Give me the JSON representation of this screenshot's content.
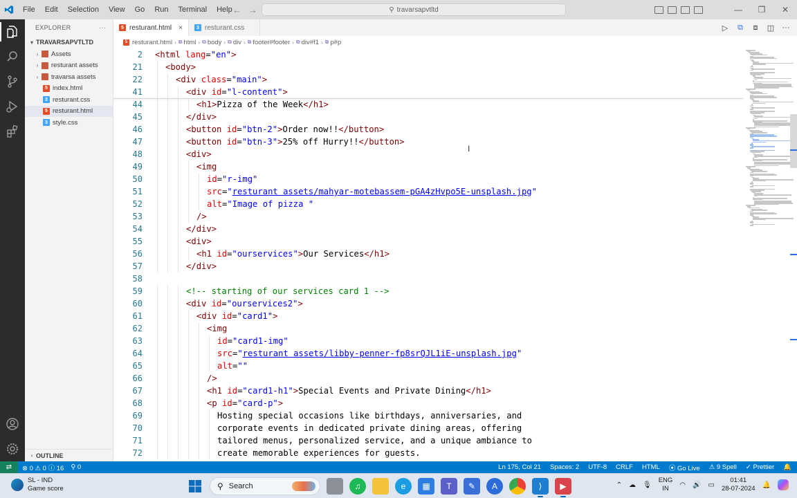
{
  "window": {
    "title": "travarsapvtltd",
    "menu": [
      "File",
      "Edit",
      "Selection",
      "View",
      "Go",
      "Run",
      "Terminal",
      "Help"
    ]
  },
  "sidebar": {
    "header": "EXPLORER",
    "more": "···",
    "root": "TRAVARSAPVTLTD",
    "items": [
      {
        "label": "Assets",
        "type": "folder"
      },
      {
        "label": "resturant assets",
        "type": "folder"
      },
      {
        "label": "travarsa assets",
        "type": "folder"
      },
      {
        "label": "index.html",
        "type": "html"
      },
      {
        "label": "resturant.css",
        "type": "css"
      },
      {
        "label": "resturant.html",
        "type": "html"
      },
      {
        "label": "style.css",
        "type": "css"
      }
    ],
    "outline": "OUTLINE"
  },
  "tabs": [
    {
      "label": "resturant.html",
      "type": "html",
      "close": "×"
    },
    {
      "label": "resturant.css",
      "type": "css"
    }
  ],
  "breadcrumb": [
    "resturant.html",
    "html",
    "body",
    "div",
    "footer#footer",
    "div#f1",
    "p#p"
  ],
  "code": {
    "sticky": [
      {
        "ln": "2",
        "indent": 0,
        "tokens": [
          [
            "p",
            "<"
          ],
          [
            "tag",
            "html"
          ],
          [
            "t",
            " "
          ],
          [
            "attr",
            "lang"
          ],
          [
            "t",
            "="
          ],
          [
            "val",
            "\"en\""
          ],
          [
            "p",
            ">"
          ]
        ]
      },
      {
        "ln": "21",
        "indent": 1,
        "tokens": [
          [
            "p",
            "<"
          ],
          [
            "tag",
            "body"
          ],
          [
            "p",
            ">"
          ]
        ]
      },
      {
        "ln": "22",
        "indent": 2,
        "tokens": [
          [
            "p",
            "<"
          ],
          [
            "tag",
            "div"
          ],
          [
            "t",
            " "
          ],
          [
            "attr",
            "class"
          ],
          [
            "t",
            "="
          ],
          [
            "val",
            "\"main\""
          ],
          [
            "p",
            ">"
          ]
        ]
      },
      {
        "ln": "41",
        "indent": 3,
        "tokens": [
          [
            "p",
            "<"
          ],
          [
            "tag",
            "div"
          ],
          [
            "t",
            " "
          ],
          [
            "attr",
            "id"
          ],
          [
            "t",
            "="
          ],
          [
            "val",
            "\"l-content\""
          ],
          [
            "p",
            ">"
          ]
        ]
      }
    ],
    "lines": [
      {
        "ln": "44",
        "indent": 4,
        "tokens": [
          [
            "p",
            "<"
          ],
          [
            "tag",
            "h1"
          ],
          [
            "p",
            ">"
          ],
          [
            "t",
            "Pizza of the Week"
          ],
          [
            "p",
            "</"
          ],
          [
            "tag",
            "h1"
          ],
          [
            "p",
            ">"
          ]
        ]
      },
      {
        "ln": "45",
        "indent": 3,
        "tokens": [
          [
            "p",
            "</"
          ],
          [
            "tag",
            "div"
          ],
          [
            "p",
            ">"
          ]
        ]
      },
      {
        "ln": "46",
        "indent": 3,
        "tokens": [
          [
            "p",
            "<"
          ],
          [
            "tag",
            "button"
          ],
          [
            "t",
            " "
          ],
          [
            "attr",
            "id"
          ],
          [
            "t",
            "="
          ],
          [
            "val",
            "\"btn-2\""
          ],
          [
            "p",
            ">"
          ],
          [
            "t",
            "Order now!!"
          ],
          [
            "p",
            "</"
          ],
          [
            "tag",
            "button"
          ],
          [
            "p",
            ">"
          ]
        ]
      },
      {
        "ln": "47",
        "indent": 3,
        "tokens": [
          [
            "p",
            "<"
          ],
          [
            "tag",
            "button"
          ],
          [
            "t",
            " "
          ],
          [
            "attr",
            "id"
          ],
          [
            "t",
            "="
          ],
          [
            "val",
            "\"btn-3\""
          ],
          [
            "p",
            ">"
          ],
          [
            "t",
            "25% off Hurry!!"
          ],
          [
            "p",
            "</"
          ],
          [
            "tag",
            "button"
          ],
          [
            "p",
            ">"
          ]
        ]
      },
      {
        "ln": "48",
        "indent": 3,
        "tokens": [
          [
            "p",
            "<"
          ],
          [
            "tag",
            "div"
          ],
          [
            "p",
            ">"
          ]
        ]
      },
      {
        "ln": "49",
        "indent": 4,
        "tokens": [
          [
            "p",
            "<"
          ],
          [
            "tag",
            "img"
          ]
        ]
      },
      {
        "ln": "50",
        "indent": 5,
        "tokens": [
          [
            "attr",
            "id"
          ],
          [
            "t",
            "="
          ],
          [
            "val",
            "\"r-img\""
          ]
        ]
      },
      {
        "ln": "51",
        "indent": 5,
        "tokens": [
          [
            "attr",
            "src"
          ],
          [
            "t",
            "="
          ],
          [
            "val",
            "\""
          ],
          [
            "link",
            "resturant assets/mahyar-motebassem-pGA4zHvpo5E-unsplash.jpg"
          ],
          [
            "val",
            "\""
          ]
        ]
      },
      {
        "ln": "52",
        "indent": 5,
        "tokens": [
          [
            "attr",
            "alt"
          ],
          [
            "t",
            "="
          ],
          [
            "val",
            "\"Image of pizza \""
          ]
        ]
      },
      {
        "ln": "53",
        "indent": 4,
        "tokens": [
          [
            "p",
            "/>"
          ]
        ]
      },
      {
        "ln": "54",
        "indent": 3,
        "tokens": [
          [
            "p",
            "</"
          ],
          [
            "tag",
            "div"
          ],
          [
            "p",
            ">"
          ]
        ]
      },
      {
        "ln": "55",
        "indent": 3,
        "tokens": [
          [
            "p",
            "<"
          ],
          [
            "tag",
            "div"
          ],
          [
            "p",
            ">"
          ]
        ]
      },
      {
        "ln": "56",
        "indent": 4,
        "tokens": [
          [
            "p",
            "<"
          ],
          [
            "tag",
            "h1"
          ],
          [
            "t",
            " "
          ],
          [
            "attr",
            "id"
          ],
          [
            "t",
            "="
          ],
          [
            "val",
            "\"ourservices\""
          ],
          [
            "p",
            ">"
          ],
          [
            "t",
            "Our Services"
          ],
          [
            "p",
            "</"
          ],
          [
            "tag",
            "h1"
          ],
          [
            "p",
            ">"
          ]
        ]
      },
      {
        "ln": "57",
        "indent": 3,
        "tokens": [
          [
            "p",
            "</"
          ],
          [
            "tag",
            "div"
          ],
          [
            "p",
            ">"
          ]
        ]
      },
      {
        "ln": "58",
        "indent": 0,
        "tokens": []
      },
      {
        "ln": "59",
        "indent": 3,
        "tokens": [
          [
            "c",
            "<!-- starting of our services card 1 -->"
          ]
        ]
      },
      {
        "ln": "60",
        "indent": 3,
        "tokens": [
          [
            "p",
            "<"
          ],
          [
            "tag",
            "div"
          ],
          [
            "t",
            " "
          ],
          [
            "attr",
            "id"
          ],
          [
            "t",
            "="
          ],
          [
            "val",
            "\"ourservices2\""
          ],
          [
            "p",
            ">"
          ]
        ]
      },
      {
        "ln": "61",
        "indent": 4,
        "tokens": [
          [
            "p",
            "<"
          ],
          [
            "tag",
            "div"
          ],
          [
            "t",
            " "
          ],
          [
            "attr",
            "id"
          ],
          [
            "t",
            "="
          ],
          [
            "val",
            "\"card1\""
          ],
          [
            "p",
            ">"
          ]
        ]
      },
      {
        "ln": "62",
        "indent": 5,
        "tokens": [
          [
            "p",
            "<"
          ],
          [
            "tag",
            "img"
          ]
        ]
      },
      {
        "ln": "63",
        "indent": 6,
        "tokens": [
          [
            "attr",
            "id"
          ],
          [
            "t",
            "="
          ],
          [
            "val",
            "\"card1-img\""
          ]
        ]
      },
      {
        "ln": "64",
        "indent": 6,
        "tokens": [
          [
            "attr",
            "src"
          ],
          [
            "t",
            "="
          ],
          [
            "val",
            "\""
          ],
          [
            "link",
            "resturant assets/libby-penner-fp8srQJL1iE-unsplash.jpg"
          ],
          [
            "val",
            "\""
          ]
        ]
      },
      {
        "ln": "65",
        "indent": 6,
        "tokens": [
          [
            "attr",
            "alt"
          ],
          [
            "t",
            "="
          ],
          [
            "val",
            "\"\""
          ]
        ]
      },
      {
        "ln": "66",
        "indent": 5,
        "tokens": [
          [
            "p",
            "/>"
          ]
        ]
      },
      {
        "ln": "67",
        "indent": 5,
        "tokens": [
          [
            "p",
            "<"
          ],
          [
            "tag",
            "h1"
          ],
          [
            "t",
            " "
          ],
          [
            "attr",
            "id"
          ],
          [
            "t",
            "="
          ],
          [
            "val",
            "\"card1-h1\""
          ],
          [
            "p",
            ">"
          ],
          [
            "t",
            "Special Events and Private Dining"
          ],
          [
            "p",
            "</"
          ],
          [
            "tag",
            "h1"
          ],
          [
            "p",
            ">"
          ]
        ]
      },
      {
        "ln": "68",
        "indent": 5,
        "tokens": [
          [
            "p",
            "<"
          ],
          [
            "tag",
            "p"
          ],
          [
            "t",
            " "
          ],
          [
            "attr",
            "id"
          ],
          [
            "t",
            "="
          ],
          [
            "val",
            "\"card-p\""
          ],
          [
            "p",
            ">"
          ]
        ]
      },
      {
        "ln": "69",
        "indent": 6,
        "tokens": [
          [
            "t",
            "Hosting special occasions like birthdays, anniversaries, and"
          ]
        ]
      },
      {
        "ln": "70",
        "indent": 6,
        "tokens": [
          [
            "t",
            "corporate events in dedicated private dining areas, offering"
          ]
        ]
      },
      {
        "ln": "71",
        "indent": 6,
        "tokens": [
          [
            "t",
            "tailored menus, personalized service, and a unique ambiance to"
          ]
        ]
      },
      {
        "ln": "72",
        "indent": 6,
        "tokens": [
          [
            "t",
            "create memorable experiences for guests."
          ]
        ]
      }
    ]
  },
  "statusbar": {
    "remote": "⇄",
    "problems": "⊗ 0 ⚠ 0 ⓘ 16",
    "ports": "⚲ 0",
    "position": "Ln 175, Col 21",
    "spaces": "Spaces: 2",
    "encoding": "UTF-8",
    "eol": "CRLF",
    "language": "HTML",
    "golive": "⦿ Go Live",
    "spell": "⚠ 9 Spell",
    "prettier": "✓ Prettier",
    "bell": "🔔"
  },
  "taskbar": {
    "weather_title": "SL - IND",
    "weather_sub": "Game score",
    "search": "Search",
    "lang_top": "ENG",
    "lang_bottom": "IN",
    "time": "01:41",
    "date": "28-07-2024"
  },
  "colors": {
    "accent": "#007acc",
    "activitybar": "#2c2c2c",
    "remote": "#16825d"
  }
}
